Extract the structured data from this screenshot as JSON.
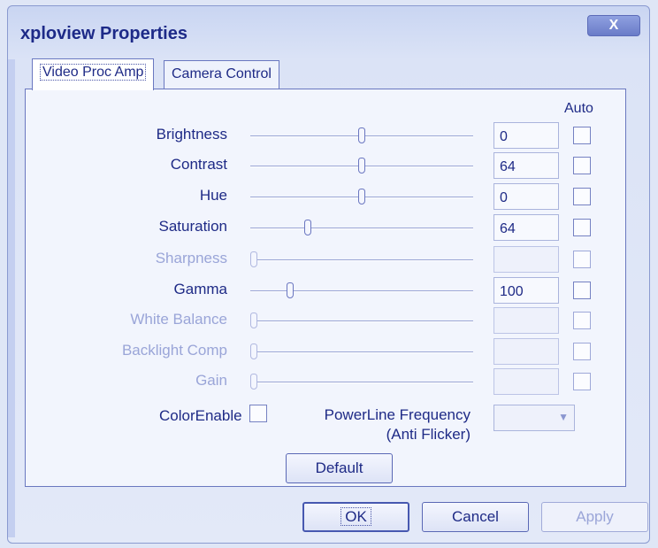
{
  "window": {
    "title": "xploview Properties",
    "close_glyph": "X"
  },
  "tabs": [
    {
      "label": "Video Proc Amp",
      "active": true
    },
    {
      "label": "Camera Control",
      "active": false
    }
  ],
  "auto_header": "Auto",
  "controls": [
    {
      "label": "Brightness",
      "value": "0",
      "enabled": true,
      "level": 0.5
    },
    {
      "label": "Contrast",
      "value": "64",
      "enabled": true,
      "level": 0.5
    },
    {
      "label": "Hue",
      "value": "0",
      "enabled": true,
      "level": 0.5
    },
    {
      "label": "Saturation",
      "value": "64",
      "enabled": true,
      "level": 0.25
    },
    {
      "label": "Sharpness",
      "value": "",
      "enabled": false,
      "level": 0.0
    },
    {
      "label": "Gamma",
      "value": "100",
      "enabled": true,
      "level": 0.17
    },
    {
      "label": "White Balance",
      "value": "",
      "enabled": false,
      "level": 0.0
    },
    {
      "label": "Backlight Comp",
      "value": "",
      "enabled": false,
      "level": 0.0
    },
    {
      "label": "Gain",
      "value": "",
      "enabled": false,
      "level": 0.0
    }
  ],
  "color_enable": {
    "label": "ColorEnable"
  },
  "powerline": {
    "label_line1": "PowerLine Frequency",
    "label_line2": "(Anti Flicker)",
    "selected": ""
  },
  "buttons": {
    "default": "Default",
    "ok": "OK",
    "cancel": "Cancel",
    "apply": "Apply"
  },
  "colors": {
    "text": "#1e2a86",
    "disabled_text": "#9aa5d8",
    "background": "#dfe6f6"
  }
}
